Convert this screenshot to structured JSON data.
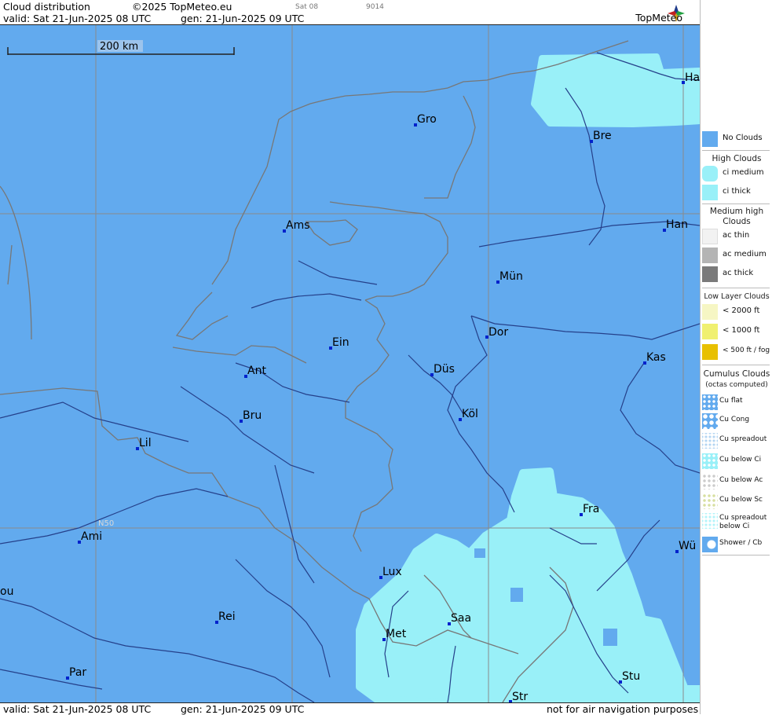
{
  "header": {
    "product": "Cloud distribution",
    "copyright": "©2025 TopMeteo.eu",
    "sat": "Sat 08",
    "code": "9014",
    "valid": "valid:  Sat  21-Jun-2025  08 UTC",
    "gen": "gen: 21-Jun-2025 09 UTC",
    "logo": "TopMeteo"
  },
  "footer": {
    "valid": "valid:  Sat  21-Jun-2025  08 UTC",
    "gen": "gen: 21-Jun-2025 09 UTC",
    "notice": "not for air navigation purposes"
  },
  "map": {
    "scale_label": "200 km",
    "latitude_label": "N50",
    "cities": [
      "Ha",
      "Gro",
      "Bre",
      "Ams",
      "Han",
      "Mün",
      "Dor",
      "Ein",
      "Ant",
      "Düs",
      "Kas",
      "Bru",
      "Köl",
      "Lil",
      "Fra",
      "Ami",
      "Wü",
      "ou",
      "Lux",
      "Rei",
      "Saa",
      "Met",
      "Stu",
      "Par",
      "Str"
    ],
    "colors": {
      "no_clouds": "#62aaee",
      "ci_thick": "#99f0f8",
      "ci_medium": "#8cd8f0",
      "border": "#777777",
      "river": "#25408a",
      "grid": "#8a8a8a"
    }
  },
  "legend": {
    "no_clouds": "No Clouds",
    "high_clouds": "High Clouds",
    "ci_medium": "ci medium",
    "ci_thick": "ci thick",
    "medium_high_1": "Medium high",
    "medium_high_2": "Clouds",
    "ac_thin": "ac thin",
    "ac_medium": "ac medium",
    "ac_thick": "ac thick",
    "low_layer": "Low Layer Clouds",
    "low_2000": "< 2000 ft",
    "low_1000": "< 1000 ft",
    "low_500": "< 500 ft / fog",
    "cumulus_1": "Cumulus Clouds",
    "cumulus_2": "(octas computed)",
    "cu_flat": "Cu flat",
    "cu_cong": "Cu Cong",
    "cu_spreadout": "Cu spreadout",
    "cu_below_ci": "Cu below Ci",
    "cu_below_ac": "Cu below Ac",
    "cu_below_sc": "Cu below Sc",
    "cu_spread_below_ci_1": "Cu spreadout",
    "cu_spread_below_ci_2": "below Ci",
    "shower": "Shower / Cb"
  }
}
